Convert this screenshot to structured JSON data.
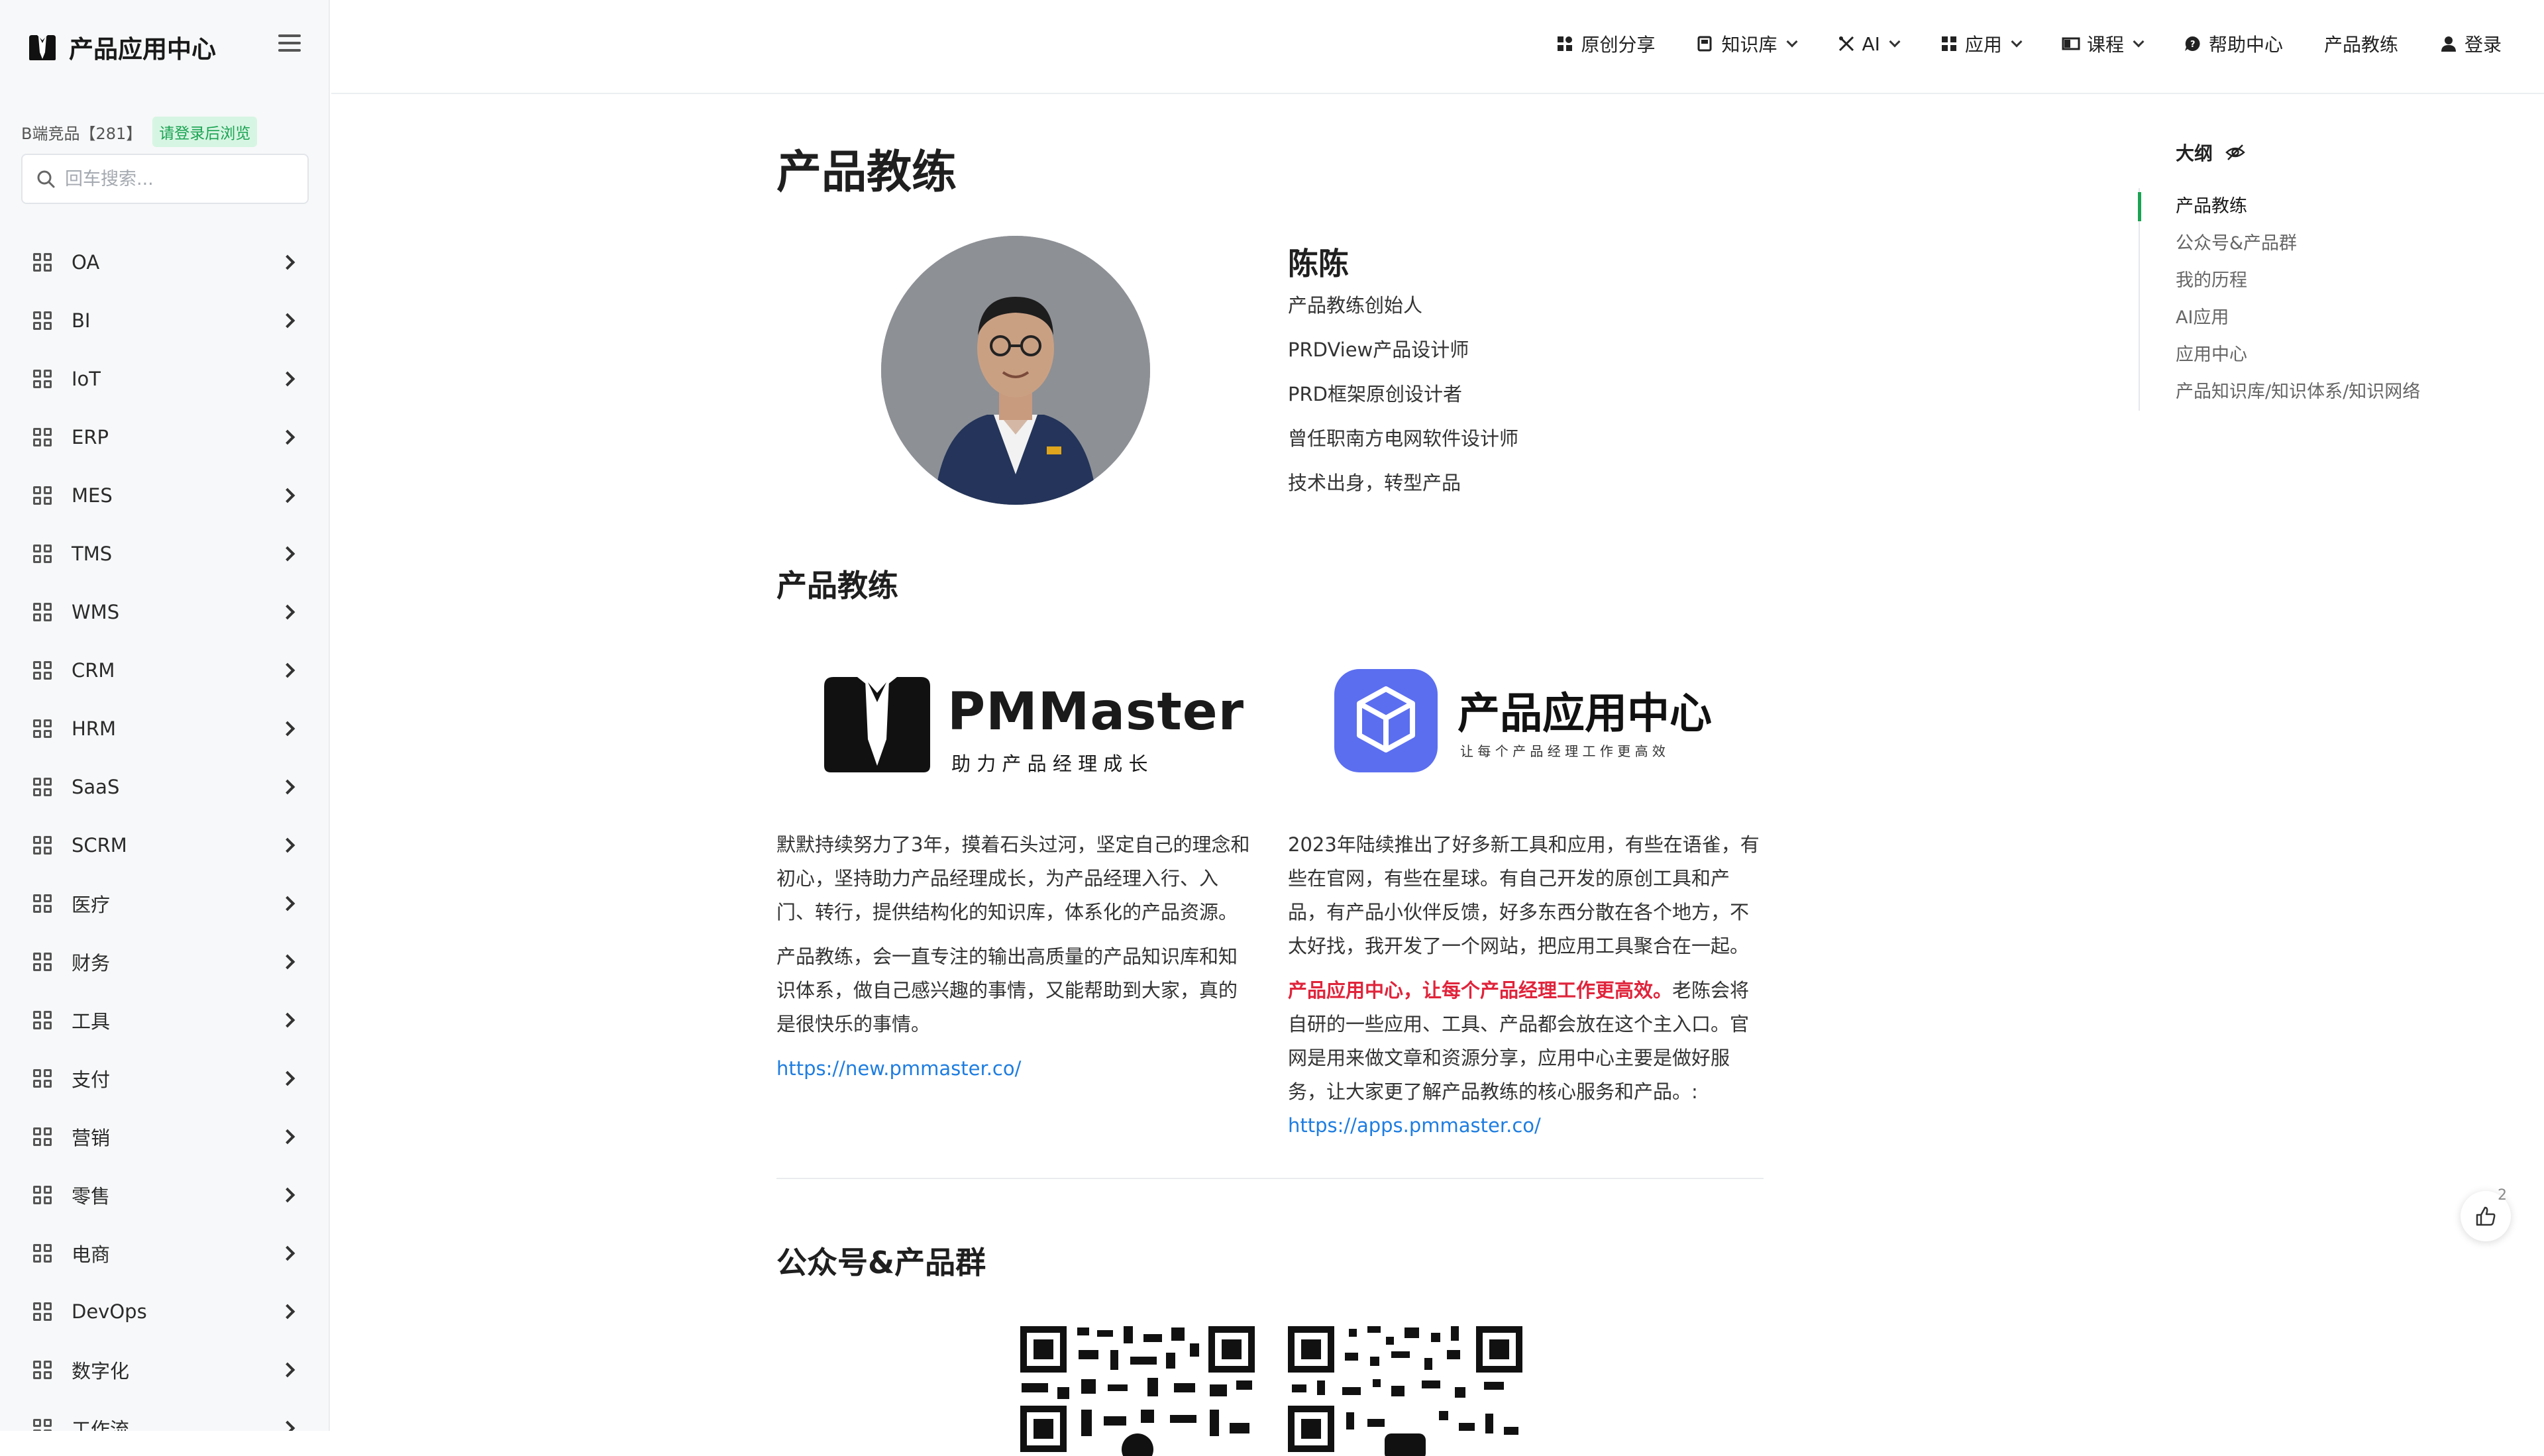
{
  "sidebar": {
    "brand": "产品应用中心",
    "promo_text": "B端竞品【281】",
    "promo_badge": "请登录后浏览",
    "search_placeholder": "回车搜索...",
    "items": [
      {
        "label": "OA"
      },
      {
        "label": "BI"
      },
      {
        "label": "IoT"
      },
      {
        "label": "ERP"
      },
      {
        "label": "MES"
      },
      {
        "label": "TMS"
      },
      {
        "label": "WMS"
      },
      {
        "label": "CRM"
      },
      {
        "label": "HRM"
      },
      {
        "label": "SaaS"
      },
      {
        "label": "SCRM"
      },
      {
        "label": "医疗"
      },
      {
        "label": "财务"
      },
      {
        "label": "工具"
      },
      {
        "label": "支付"
      },
      {
        "label": "营销"
      },
      {
        "label": "零售"
      },
      {
        "label": "电商"
      },
      {
        "label": "DevOps"
      },
      {
        "label": "数字化"
      },
      {
        "label": "工作流"
      }
    ]
  },
  "topnav": {
    "original": "原创分享",
    "knowledge": "知识库",
    "ai": "AI",
    "apps": "应用",
    "course": "课程",
    "help": "帮助中心",
    "coach": "产品教练",
    "login": "登录"
  },
  "main": {
    "title": "产品教练",
    "profile": {
      "name": "陈陈",
      "roles": [
        "产品教练创始人",
        "PRDView产品设计师",
        "PRD框架原创设计者",
        "曾任职南方电网软件设计师",
        "技术出身，转型产品"
      ]
    },
    "section1": "产品教练",
    "pm_logo": {
      "name": "PMMaster",
      "slogan": "助 力 产 品 经 理 成 长"
    },
    "app_logo": {
      "name": "产品应用中心",
      "slogan": "让 每 个 产 品 经 理 工 作 更 高 效"
    },
    "left_col": {
      "p1": "默默持续努力了3年，摸着石头过河，坚定自己的理念和初心，坚持助力产品经理成长，为产品经理入行、入门、转行，提供结构化的知识库，体系化的产品资源。",
      "p2": "产品教练，会一直专注的输出高质量的产品知识库和知识体系，做自己感兴趣的事情，又能帮助到大家，真的是很快乐的事情。",
      "link": "https://new.pmmaster.co/"
    },
    "right_col": {
      "p1": "2023年陆续推出了好多新工具和应用，有些在语雀，有些在官网，有些在星球。有自己开发的原创工具和产品，有产品小伙伴反馈，好多东西分散在各个地方，不太好找，我开发了一个网站，把应用工具聚合在一起。",
      "red": "产品应用中心，让每个产品经理工作更高效。",
      "p2": "老陈会将自研的一些应用、工具、产品都会放在这个主入口。官网是用来做文章和资源分享，应用中心主要是做好服务，让大家更了解产品教练的核心服务和产品。:",
      "link": "https://apps.pmmaster.co/"
    },
    "section2": "公众号&产品群"
  },
  "outline": {
    "title": "大纲",
    "items": [
      "产品教练",
      "公众号&产品群",
      "我的历程",
      "AI应用",
      "应用中心",
      "产品知识库/知识体系/知识网络"
    ]
  },
  "like_count": "2",
  "colors": {
    "accent": "#1aa352",
    "link": "#1e7de0",
    "highlight": "#e0243b",
    "app_logo": "#5b6ef0"
  }
}
